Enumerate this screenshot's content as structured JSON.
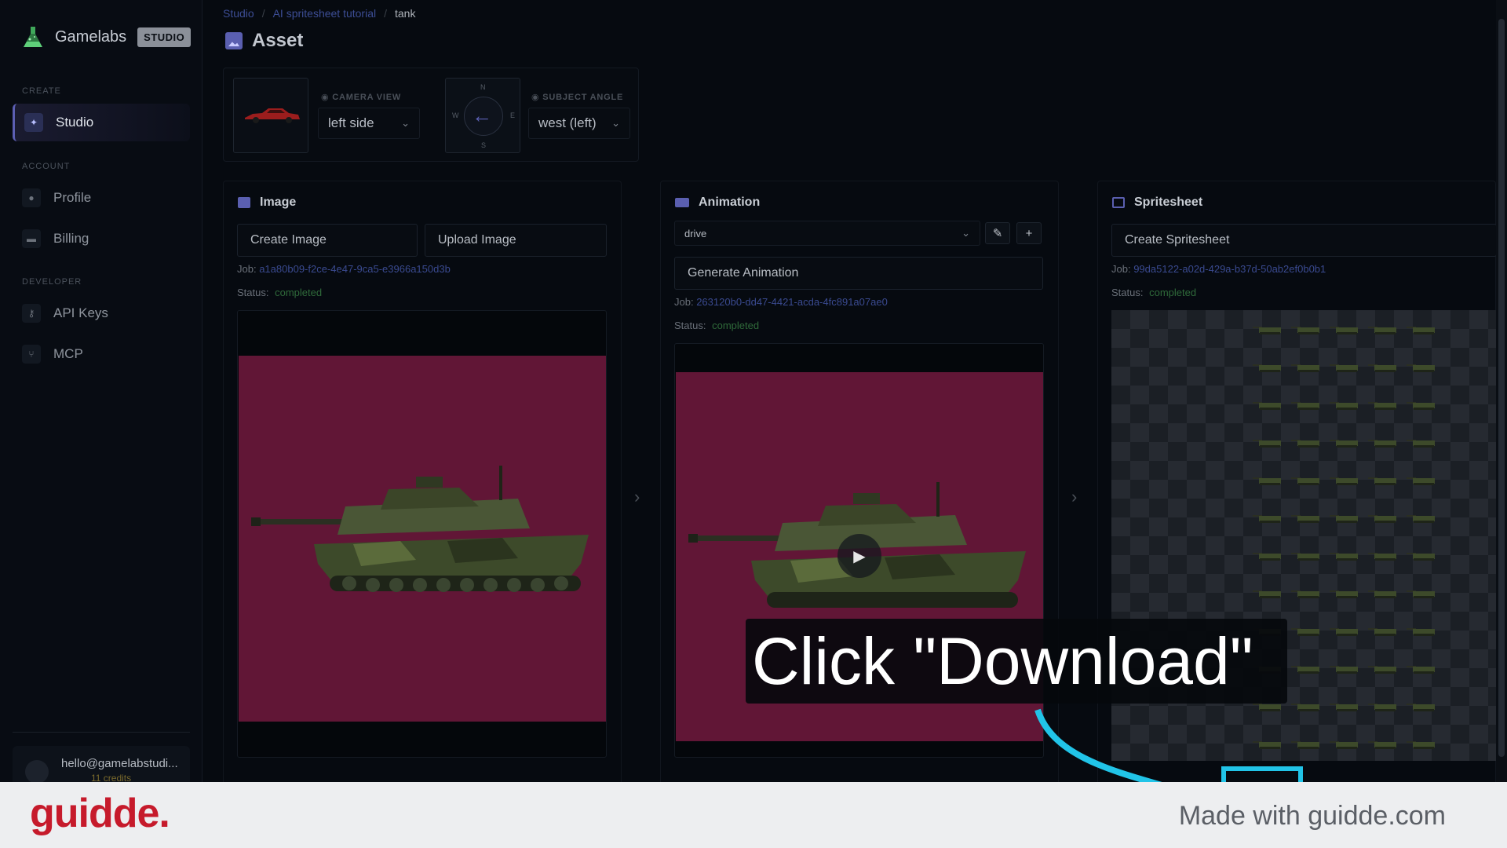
{
  "sidebar": {
    "brand": "Gamelabs",
    "badge": "STUDIO",
    "sections": {
      "create": "CREATE",
      "account": "ACCOUNT",
      "developer": "DEVELOPER"
    },
    "items": [
      {
        "label": "Studio",
        "icon": "magic-wand-icon",
        "active": true
      },
      {
        "label": "Profile",
        "icon": "user-icon"
      },
      {
        "label": "Billing",
        "icon": "credit-card-icon"
      },
      {
        "label": "API Keys",
        "icon": "key-icon"
      },
      {
        "label": "MCP",
        "icon": "branch-icon"
      }
    ],
    "user": {
      "email": "hello@gamelabstudi...",
      "credits": "11 credits"
    }
  },
  "breadcrumb": [
    "Studio",
    "AI spritesheet tutorial",
    "tank"
  ],
  "page": {
    "title": "Asset"
  },
  "config": {
    "camera_view_label": "CAMERA VIEW",
    "camera_view_value": "left side",
    "compass": {
      "n": "N",
      "s": "S",
      "e": "E",
      "w": "W"
    },
    "subject_angle_label": "SUBJECT ANGLE",
    "subject_angle_value": "west (left)"
  },
  "panels": {
    "image": {
      "title": "Image",
      "create_label": "Create Image",
      "upload_label": "Upload Image",
      "job_label": "Job:",
      "job_id": "a1a80b09-f2ce-4e47-9ca5-e3966a150d3b",
      "status_label": "Status:",
      "status": "completed"
    },
    "animation": {
      "title": "Animation",
      "animation_select": "drive",
      "generate_label": "Generate Animation",
      "job_label": "Job:",
      "job_id": "263120b0-dd47-4421-acda-4fc891a07ae0",
      "status_label": "Status:",
      "status": "completed"
    },
    "spritesheet": {
      "title": "Spritesheet",
      "create_label": "Create Spritesheet",
      "job_label": "Job:",
      "job_id": "99da5122-a02d-429a-b37d-50ab2ef0b0b1",
      "status_label": "Status:",
      "status": "completed"
    }
  },
  "overlay": {
    "callout": "Click \"Download\""
  },
  "footer": {
    "logo": "guidde.",
    "text": "Made with guidde.com"
  },
  "colors": {
    "accent": "#5a5fb0",
    "status_ok": "#2f6a3a",
    "highlight": "#21c4e8",
    "brand_red": "#c61a2b"
  }
}
